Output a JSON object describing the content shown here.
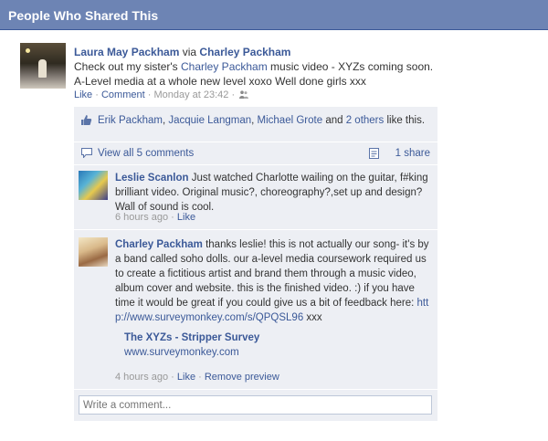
{
  "header": {
    "title": "People Who Shared This"
  },
  "post": {
    "author": "Laura May Packham",
    "via": "via",
    "source": "Charley Packham",
    "text_before": "Check out my sister's ",
    "text_link": "Charley Packham",
    "text_after": " music video - XYZs coming soon. A-Level media at a whole new level xoxo Well done girls xxx",
    "like_label": "Like",
    "comment_label": "Comment",
    "timestamp": "Monday at 23:42",
    "sep": "·"
  },
  "ufi": {
    "likes": {
      "names": [
        "Erik Packham",
        "Jacquie Langman",
        "Michael Grote"
      ],
      "and": "and",
      "others": "2 others",
      "tail": "like this."
    },
    "view_all": "View all 5 comments",
    "share_count": "1 share",
    "comments": [
      {
        "author": "Leslie Scanlon",
        "text": "Just watched Charlotte wailing on the guitar, f#king brilliant video. Original music?, choreography?,set up and design? Wall of sound is cool.",
        "time": "6 hours ago",
        "like_label": "Like"
      },
      {
        "author": "Charley Packham",
        "text": "thanks leslie! this is not actually our song- it's by a band called soho dolls. our a-level media coursework required us to create a fictitious artist and brand them through a music video, album cover and website. this is the finished video. :) if you have time it would be great if you could give us a bit of feedback here: ",
        "link": "http://www.surveymonkey.com/s/QPQSL96",
        "text_end": " xxx",
        "attachment_title": "The XYZs - Stripper Survey",
        "attachment_url": "www.surveymonkey.com",
        "time": "4 hours ago",
        "like_label": "Like",
        "remove_label": "Remove preview"
      }
    ],
    "write_placeholder": "Write a comment..."
  },
  "colors": {
    "header_bg": "#6d84b4",
    "link": "#3b5998",
    "ufi_bg": "#edeff4"
  },
  "icons": [
    "people-icon",
    "thumbs-up-icon",
    "comment-icon",
    "share-icon"
  ]
}
